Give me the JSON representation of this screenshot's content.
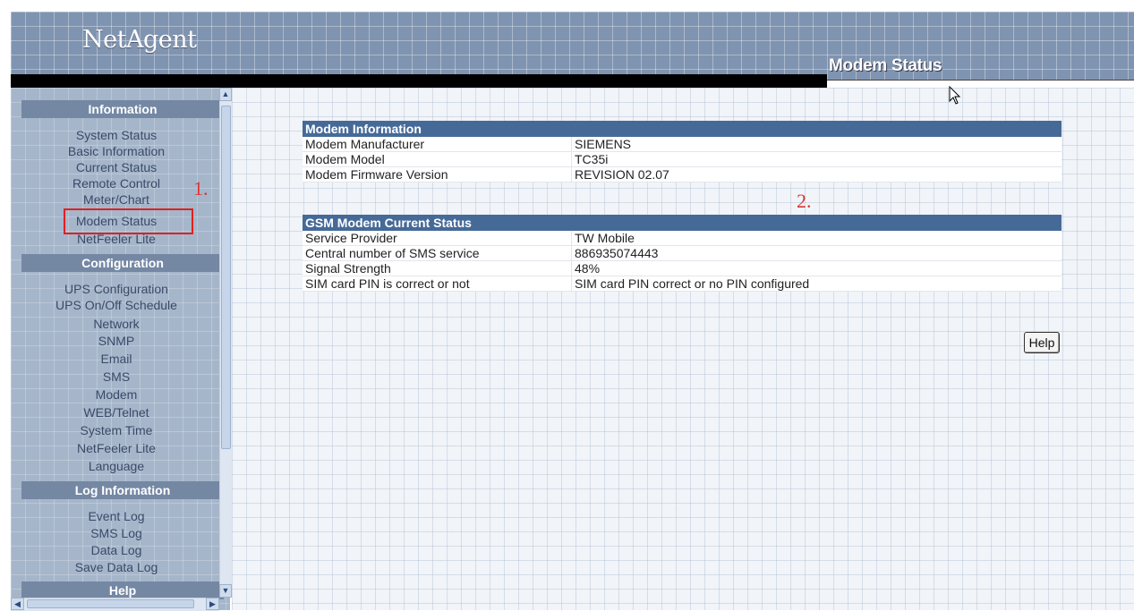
{
  "header": {
    "logo": "NetAgent",
    "page_title": "Modem Status"
  },
  "annotations": {
    "one": "1.",
    "two": "2."
  },
  "sidebar": {
    "sections": [
      {
        "title": "Information",
        "items": [
          "System Status",
          "Basic Information",
          "Current Status",
          "Remote Control",
          "Meter/Chart",
          "Modem Status",
          "NetFeeler Lite"
        ]
      },
      {
        "title": "Configuration",
        "items": [
          "UPS Configuration",
          "UPS On/Off Schedule",
          "Network",
          "SNMP",
          "Email",
          "SMS",
          "Modem",
          "WEB/Telnet",
          "System Time",
          "NetFeeler Lite",
          "Language"
        ]
      },
      {
        "title": "Log Information",
        "items": [
          "Event Log",
          "SMS Log",
          "Data Log",
          "Save Data Log"
        ]
      },
      {
        "title": "Help",
        "items": []
      }
    ],
    "active_item": "Modem Status"
  },
  "modem_info": {
    "title": "Modem Information",
    "rows": [
      {
        "label": "Modem Manufacturer",
        "value": "SIEMENS"
      },
      {
        "label": "Modem Model",
        "value": "TC35i"
      },
      {
        "label": "Modem Firmware Version",
        "value": "REVISION 02.07"
      }
    ]
  },
  "gsm_status": {
    "title": "GSM Modem Current Status",
    "rows": [
      {
        "label": "Service Provider",
        "value": "TW Mobile"
      },
      {
        "label": "Central number of SMS service",
        "value": "886935074443"
      },
      {
        "label": "Signal Strength",
        "value": "48%"
      },
      {
        "label": "SIM card PIN is correct or not",
        "value": "SIM card PIN correct or no PIN configured"
      }
    ]
  },
  "help_button": "Help",
  "colors": {
    "header": "#7f94b0",
    "section_bar": "#466a98",
    "sidebar": "#a6b6ca",
    "annotation": "#dd3333"
  }
}
